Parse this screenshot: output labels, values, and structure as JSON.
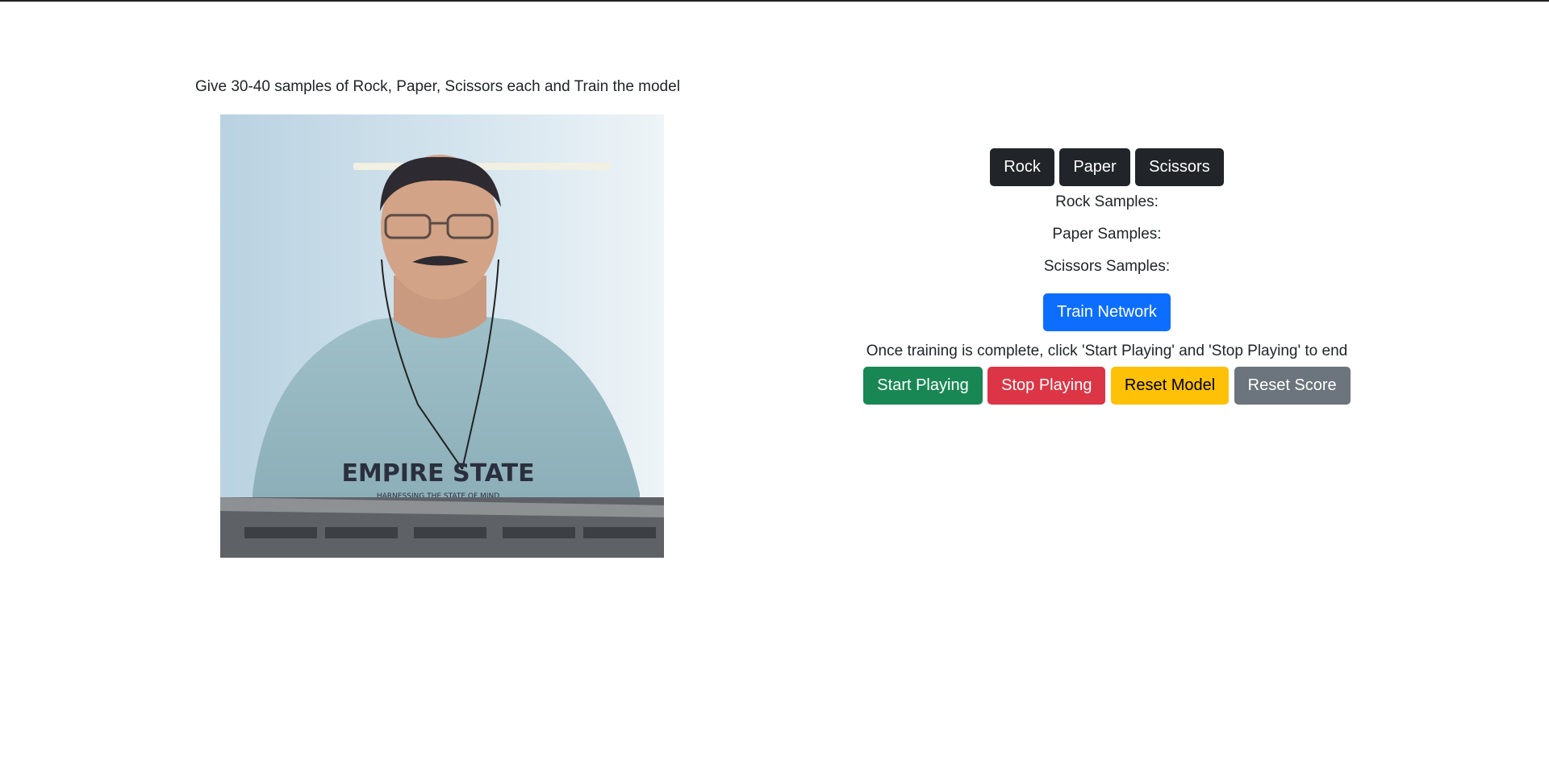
{
  "instructions": "Give 30-40 samples of Rock, Paper, Scissors each and Train the model",
  "sample_buttons": {
    "rock": "Rock",
    "paper": "Paper",
    "scissors": "Scissors"
  },
  "sample_counts": {
    "rock_label": "Rock Samples:",
    "rock_value": "",
    "paper_label": "Paper Samples:",
    "paper_value": "",
    "scissors_label": "Scissors Samples:",
    "scissors_value": ""
  },
  "train_button": "Train Network",
  "play_note": "Once training is complete, click 'Start Playing' and 'Stop Playing' to end",
  "play_buttons": {
    "start": "Start Playing",
    "stop": "Stop Playing",
    "reset_model": "Reset Model",
    "reset_score": "Reset Score"
  },
  "webcam": {
    "shirt_text": "EMPIRE STATE",
    "shirt_subtext": "HARNESSING THE STATE OF MIND"
  },
  "colors": {
    "dark": "#212529",
    "primary": "#0d6efd",
    "success": "#198754",
    "danger": "#dc3545",
    "warning": "#ffc107",
    "secondary": "#6c757d"
  }
}
